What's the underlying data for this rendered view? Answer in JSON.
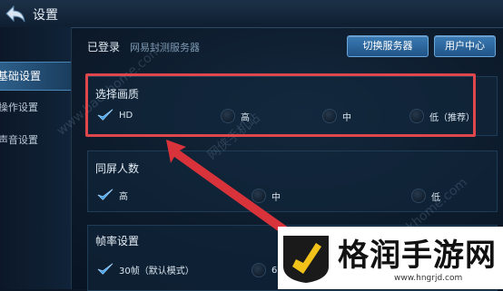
{
  "topbar": {
    "title": "设置",
    "back_icon": "back-arrow-icon"
  },
  "sidebar": {
    "items": [
      {
        "label": "基础设置",
        "active": true
      },
      {
        "label": "操作设置",
        "active": false
      },
      {
        "label": "声音设置",
        "active": false
      }
    ]
  },
  "header": {
    "login_status": "已登录",
    "server_name": "网易封测服务器",
    "switch_server_label": "切换服务器",
    "user_center_label": "用户中心"
  },
  "sections": {
    "quality": {
      "title": "选择画质",
      "options": [
        "HD",
        "高",
        "中",
        "低（推荐）"
      ],
      "selected": "HD"
    },
    "same_screen": {
      "title": "同屏人数",
      "options": [
        "高",
        "中",
        "低"
      ],
      "selected": "高"
    },
    "frame_rate": {
      "title": "帧率设置",
      "options": [
        "30帧（默认模式）",
        "6"
      ],
      "selected": "30帧（默认模式）"
    }
  },
  "watermarks": {
    "site": "www.backhome.com",
    "site2": "backhome.com",
    "brand": "网侠手机站"
  },
  "logo": {
    "text": "格润手游网",
    "url": "www.hngrjd.com"
  },
  "colors": {
    "accent": "#3b7bb4",
    "highlight_box": "#e0474c",
    "check": "#3fa0e8"
  }
}
